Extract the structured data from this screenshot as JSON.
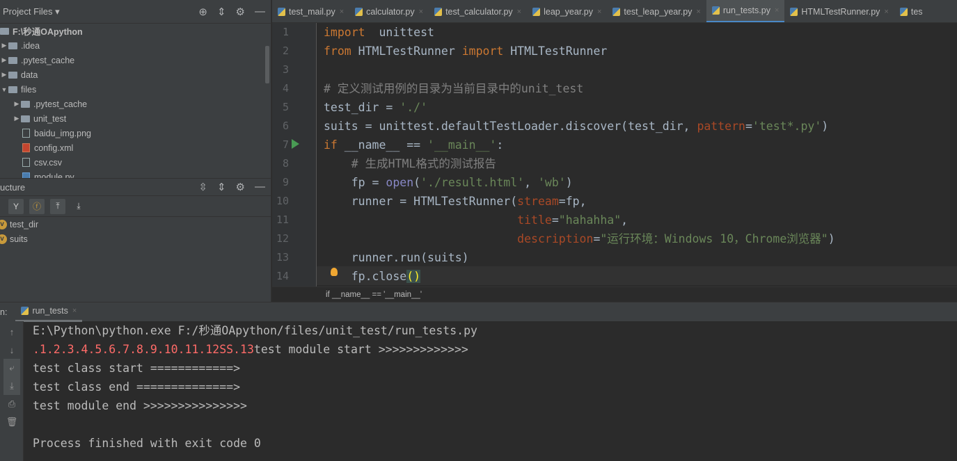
{
  "project": {
    "title": "Project Files",
    "items": [
      {
        "label": "F:\\秒通OApython",
        "type": "root",
        "indent": 0
      },
      {
        "label": ".idea",
        "type": "folder",
        "indent": 1,
        "arrow": "▶"
      },
      {
        "label": ".pytest_cache",
        "type": "folder",
        "indent": 1,
        "arrow": "▶"
      },
      {
        "label": "data",
        "type": "folder",
        "indent": 1,
        "arrow": "▶"
      },
      {
        "label": "files",
        "type": "folder",
        "indent": 1,
        "arrow": "▼"
      },
      {
        "label": ".pytest_cache",
        "type": "folder",
        "indent": 2,
        "arrow": "▶"
      },
      {
        "label": "unit_test",
        "type": "folder",
        "indent": 2,
        "arrow": "▶"
      },
      {
        "label": "baidu_img.png",
        "type": "file",
        "indent": 2
      },
      {
        "label": "config.xml",
        "type": "xml",
        "indent": 2
      },
      {
        "label": "csv.csv",
        "type": "file",
        "indent": 2
      },
      {
        "label": "module.py",
        "type": "py",
        "indent": 2
      }
    ]
  },
  "structure": {
    "title": "ucture",
    "items": [
      {
        "label": "test_dir",
        "badge": "v"
      },
      {
        "label": "suits",
        "badge": "v"
      }
    ]
  },
  "tabs": [
    {
      "label": "test_mail.py"
    },
    {
      "label": "calculator.py"
    },
    {
      "label": "test_calculator.py"
    },
    {
      "label": "leap_year.py"
    },
    {
      "label": "test_leap_year.py"
    },
    {
      "label": "run_tests.py",
      "active": true
    },
    {
      "label": "HTMLTestRunner.py"
    },
    {
      "label": "tes"
    }
  ],
  "code": [
    [
      [
        "kw",
        "import"
      ],
      [
        "",
        "  unittest"
      ]
    ],
    [
      [
        "kw",
        "from"
      ],
      [
        "",
        " HTMLTestRunner "
      ],
      [
        "kw",
        "import"
      ],
      [
        "",
        " HTMLTestRunner"
      ]
    ],
    [],
    [
      [
        "cm",
        "# 定义测试用例的目录为当前目录中的unit_test"
      ]
    ],
    [
      [
        "",
        "test_dir = "
      ],
      [
        "st",
        "'./'"
      ]
    ],
    [
      [
        "",
        "suits = unittest.defaultTestLoader.discover(test_dir, "
      ],
      [
        "pa",
        "pattern"
      ],
      [
        "",
        "="
      ],
      [
        "st",
        "'test*.py'"
      ],
      [
        "",
        ")"
      ]
    ],
    [
      [
        "kw",
        "if"
      ],
      [
        "",
        " __name__ == "
      ],
      [
        "st",
        "'__main__'"
      ],
      [
        "",
        ":"
      ]
    ],
    [
      [
        "",
        "    "
      ],
      [
        "cm",
        "# 生成HTML格式的测试报告"
      ]
    ],
    [
      [
        "",
        "    fp = "
      ],
      [
        "bi",
        "open"
      ],
      [
        "",
        "("
      ],
      [
        "st",
        "'./result.html'"
      ],
      [
        "",
        ", "
      ],
      [
        "st",
        "'wb'"
      ],
      [
        "",
        ")"
      ]
    ],
    [
      [
        "",
        "    runner = HTMLTestRunner("
      ],
      [
        "pa",
        "stream"
      ],
      [
        "",
        "=fp,"
      ]
    ],
    [
      [
        "",
        "                            "
      ],
      [
        "pa",
        "title"
      ],
      [
        "",
        "="
      ],
      [
        "st",
        "\"hahahha\""
      ],
      [
        "",
        ","
      ]
    ],
    [
      [
        "",
        "                            "
      ],
      [
        "pa",
        "description"
      ],
      [
        "",
        "="
      ],
      [
        "st",
        "\"运行环境：Windows 10，Chrome浏览器\""
      ],
      [
        "",
        ")"
      ]
    ],
    [
      [
        "",
        "    runner.run(suits)"
      ]
    ],
    [
      [
        "",
        "    fp.close"
      ],
      [
        "br",
        "()"
      ]
    ]
  ],
  "breadcrumb": "if __name__ == '__main__'",
  "run": {
    "prefix": "n:",
    "tab": "run_tests"
  },
  "console": [
    [
      [
        "",
        "E:\\Python\\python.exe F:/秒通OApython/files/unit_test/run_tests.py"
      ]
    ],
    [
      [
        "red",
        ".1.2.3.4.5.6.7.8.9.10.11.12SS.13"
      ],
      [
        "",
        "test module start >>>>>>>>>>>>>"
      ]
    ],
    [
      [
        "",
        "test class start ============>"
      ]
    ],
    [
      [
        "",
        "test class end ==============>"
      ]
    ],
    [
      [
        "",
        "test module end >>>>>>>>>>>>>>>"
      ]
    ],
    [],
    [
      [
        "",
        "Process finished with exit code 0"
      ]
    ]
  ]
}
